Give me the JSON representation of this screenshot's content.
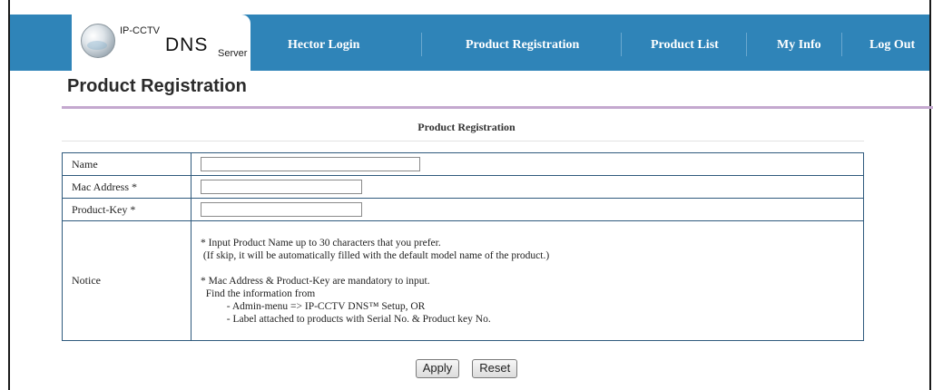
{
  "brand": {
    "top": "IP-CCTV",
    "main": "DNS",
    "sub": "Server"
  },
  "nav": [
    {
      "label": "Hector Login"
    },
    {
      "label": "Product Registration"
    },
    {
      "label": "Product List"
    },
    {
      "label": "My Info"
    },
    {
      "label": "Log Out"
    }
  ],
  "page_title": "Product Registration",
  "form": {
    "caption": "Product Registration",
    "fields": [
      {
        "label": "Name",
        "value": ""
      },
      {
        "label": "Mac Address *",
        "value": ""
      },
      {
        "label": "Product-Key *",
        "value": ""
      }
    ],
    "notice_label": "Notice",
    "notice_lines": [
      "* Input Product Name up to 30 characters that you prefer.",
      " (If skip, it will be automatically filled with the default model name of the product.)",
      "",
      "* Mac Address & Product-Key are mandatory to input.",
      "  Find the information from",
      "          - Admin-menu => IP-CCTV DNS™ Setup, OR",
      "          - Label attached to products with Serial No. & Product key No."
    ]
  },
  "buttons": {
    "apply": "Apply",
    "reset": "Reset"
  },
  "colors": {
    "nav_bg": "#2f84b8",
    "title_rule": "#c4a8cf",
    "table_border": "#2f5a7d"
  }
}
